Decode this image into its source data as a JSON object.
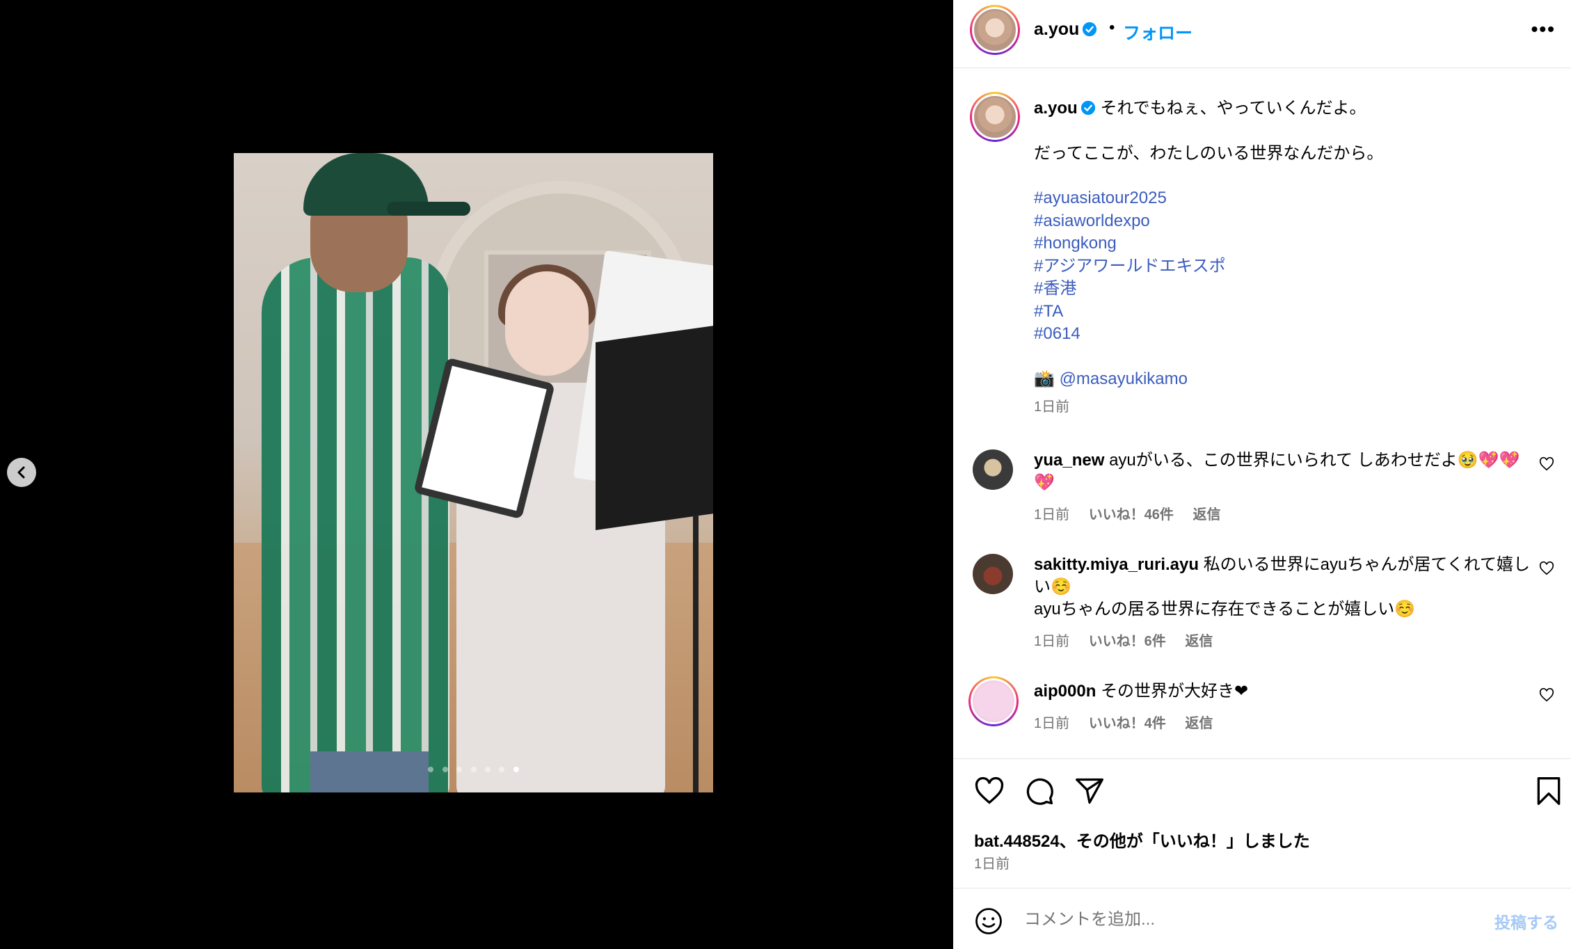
{
  "colors": {
    "accent": "#0095f6",
    "hashtag": "#3b5cbd",
    "muted": "#737373",
    "verified": "#0095f6"
  },
  "media": {
    "slide_count": 7,
    "active_slide": 7,
    "prev_icon": "chevron-left-icon"
  },
  "header": {
    "username": "a.you",
    "separator": "•",
    "follow_label": "フォロー",
    "more_label": "•••"
  },
  "caption": {
    "username": "a.you",
    "line1": "それでもねぇ、やっていくんだよ。",
    "line2": "だってここが、わたしのいる世界なんだから。",
    "hashtags": [
      "#ayuasiatour2025",
      "#asiaworldexpo",
      "#hongkong",
      "#アジアワールドエキスポ",
      "#香港",
      "#TA",
      "#0614"
    ],
    "credit_emoji": "📸",
    "credit_user": "@masayukikamo",
    "time": "1日前"
  },
  "comments": [
    {
      "username": "yua_new",
      "text": "ayuがいる、この世界にいられて しあわせだよ🥹💖💖💖",
      "time": "1日前",
      "likes": "いいね！46件",
      "reply": "返信"
    },
    {
      "username": "sakitty.miya_ruri.ayu",
      "text": "私のいる世界にayuちゃんが居てくれて嬉しい☺️",
      "text2": "ayuちゃんの居る世界に存在できることが嬉しい☺️",
      "time": "1日前",
      "likes": "いいね！6件",
      "reply": "返信"
    },
    {
      "username": "aip000n",
      "text": "その世界が大好き❤",
      "time": "1日前",
      "likes": "いいね！4件",
      "reply": "返信"
    }
  ],
  "actions": {
    "liked_by_user": "bat.448524",
    "liked_by_rest": "、その他が「いいね！」しました",
    "time": "1日前"
  },
  "add_comment": {
    "placeholder": "コメントを追加...",
    "post_label": "投稿する"
  }
}
